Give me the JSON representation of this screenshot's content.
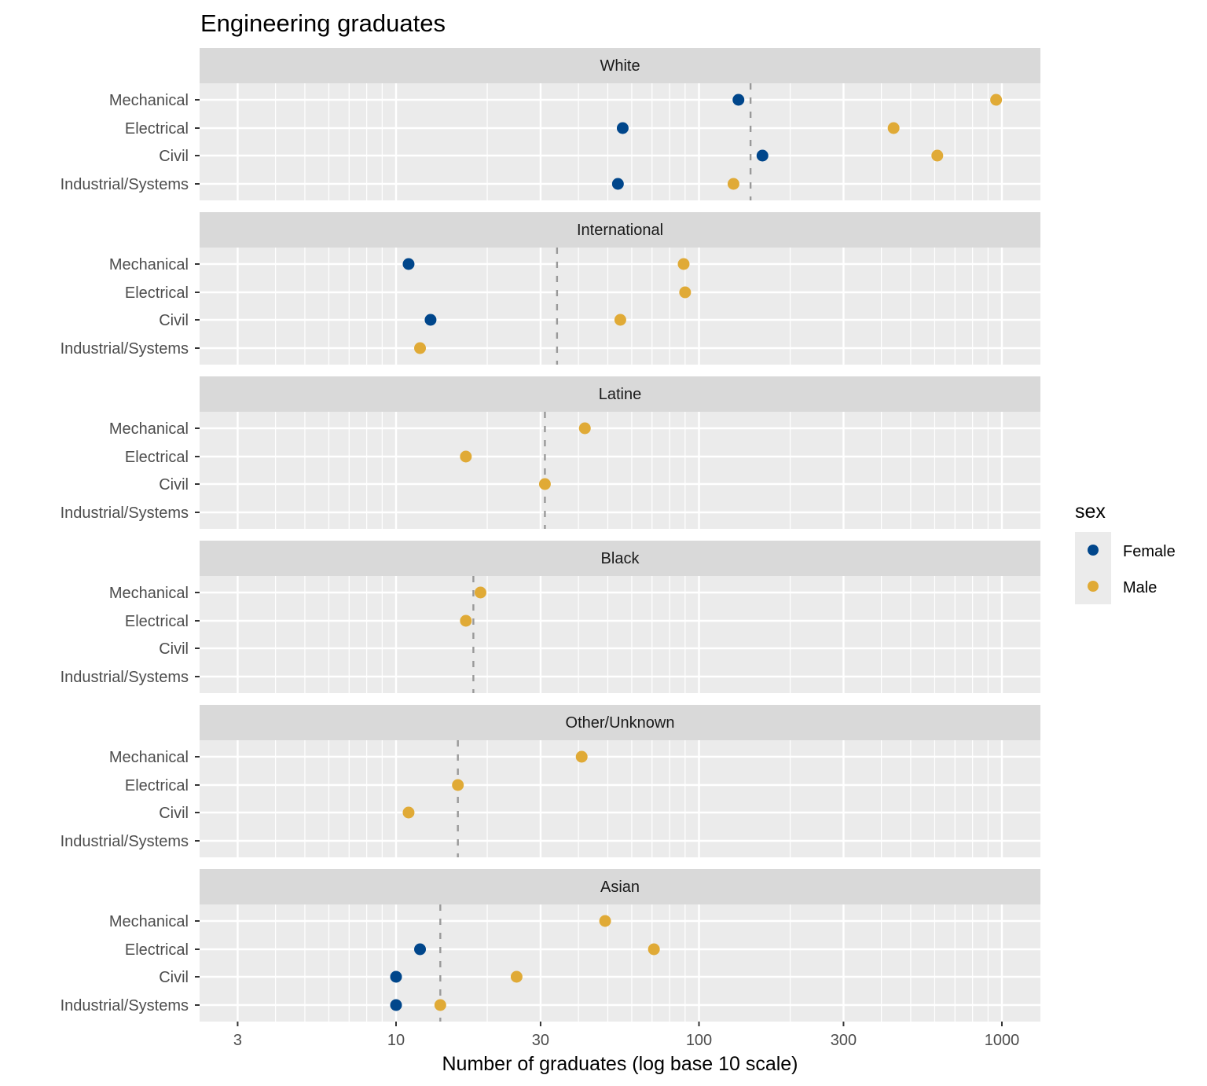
{
  "chart_data": {
    "type": "scatter",
    "title": "Engineering graduates",
    "xlabel": "Number of graduates (log base 10 scale)",
    "ylabel": "",
    "x_scale": "log10",
    "xlim": [
      2.2,
      1150
    ],
    "x_ticks": [
      3,
      10,
      30,
      100,
      300,
      1000
    ],
    "x_tick_labels": [
      "3",
      "10",
      "30",
      "100",
      "300",
      "1000"
    ],
    "x_minor_gridlines": [
      4,
      5,
      6,
      7,
      8,
      9,
      20,
      40,
      50,
      60,
      70,
      80,
      90,
      200,
      400,
      500,
      600,
      700,
      800,
      900
    ],
    "categories": [
      "Mechanical",
      "Electrical",
      "Civil",
      "Industrial/Systems"
    ],
    "grid": true,
    "legend": {
      "title": "sex",
      "position": "right",
      "entries": [
        {
          "name": "Female",
          "color": "#00468b"
        },
        {
          "name": "Male",
          "color": "#e0aa36"
        }
      ]
    },
    "reference_line": {
      "style": "dashed",
      "color": "#999999",
      "meaning": "facet median"
    },
    "facets": [
      {
        "name": "White",
        "median": 148,
        "points": [
          {
            "program": "Mechanical",
            "sex": "Female",
            "value": 135
          },
          {
            "program": "Mechanical",
            "sex": "Male",
            "value": 957
          },
          {
            "program": "Electrical",
            "sex": "Female",
            "value": 56
          },
          {
            "program": "Electrical",
            "sex": "Male",
            "value": 439
          },
          {
            "program": "Civil",
            "sex": "Female",
            "value": 162
          },
          {
            "program": "Civil",
            "sex": "Male",
            "value": 612
          },
          {
            "program": "Industrial/Systems",
            "sex": "Female",
            "value": 54
          },
          {
            "program": "Industrial/Systems",
            "sex": "Male",
            "value": 130
          }
        ]
      },
      {
        "name": "International",
        "median": 34,
        "points": [
          {
            "program": "Mechanical",
            "sex": "Female",
            "value": 11
          },
          {
            "program": "Mechanical",
            "sex": "Male",
            "value": 89
          },
          {
            "program": "Electrical",
            "sex": "Male",
            "value": 90
          },
          {
            "program": "Civil",
            "sex": "Female",
            "value": 13
          },
          {
            "program": "Civil",
            "sex": "Male",
            "value": 55
          },
          {
            "program": "Industrial/Systems",
            "sex": "Male",
            "value": 12
          }
        ]
      },
      {
        "name": "Latine",
        "median": 31,
        "points": [
          {
            "program": "Mechanical",
            "sex": "Male",
            "value": 42
          },
          {
            "program": "Electrical",
            "sex": "Male",
            "value": 17
          },
          {
            "program": "Civil",
            "sex": "Male",
            "value": 31
          }
        ]
      },
      {
        "name": "Black",
        "median": 18,
        "points": [
          {
            "program": "Mechanical",
            "sex": "Male",
            "value": 19
          },
          {
            "program": "Electrical",
            "sex": "Male",
            "value": 17
          }
        ]
      },
      {
        "name": "Other/Unknown",
        "median": 16,
        "points": [
          {
            "program": "Mechanical",
            "sex": "Male",
            "value": 41
          },
          {
            "program": "Electrical",
            "sex": "Male",
            "value": 16
          },
          {
            "program": "Civil",
            "sex": "Male",
            "value": 11
          }
        ]
      },
      {
        "name": "Asian",
        "median": 14,
        "points": [
          {
            "program": "Mechanical",
            "sex": "Male",
            "value": 49
          },
          {
            "program": "Electrical",
            "sex": "Female",
            "value": 12
          },
          {
            "program": "Electrical",
            "sex": "Male",
            "value": 71
          },
          {
            "program": "Civil",
            "sex": "Female",
            "value": 10
          },
          {
            "program": "Civil",
            "sex": "Male",
            "value": 25
          },
          {
            "program": "Industrial/Systems",
            "sex": "Female",
            "value": 10
          },
          {
            "program": "Industrial/Systems",
            "sex": "Male",
            "value": 14
          }
        ]
      }
    ]
  }
}
